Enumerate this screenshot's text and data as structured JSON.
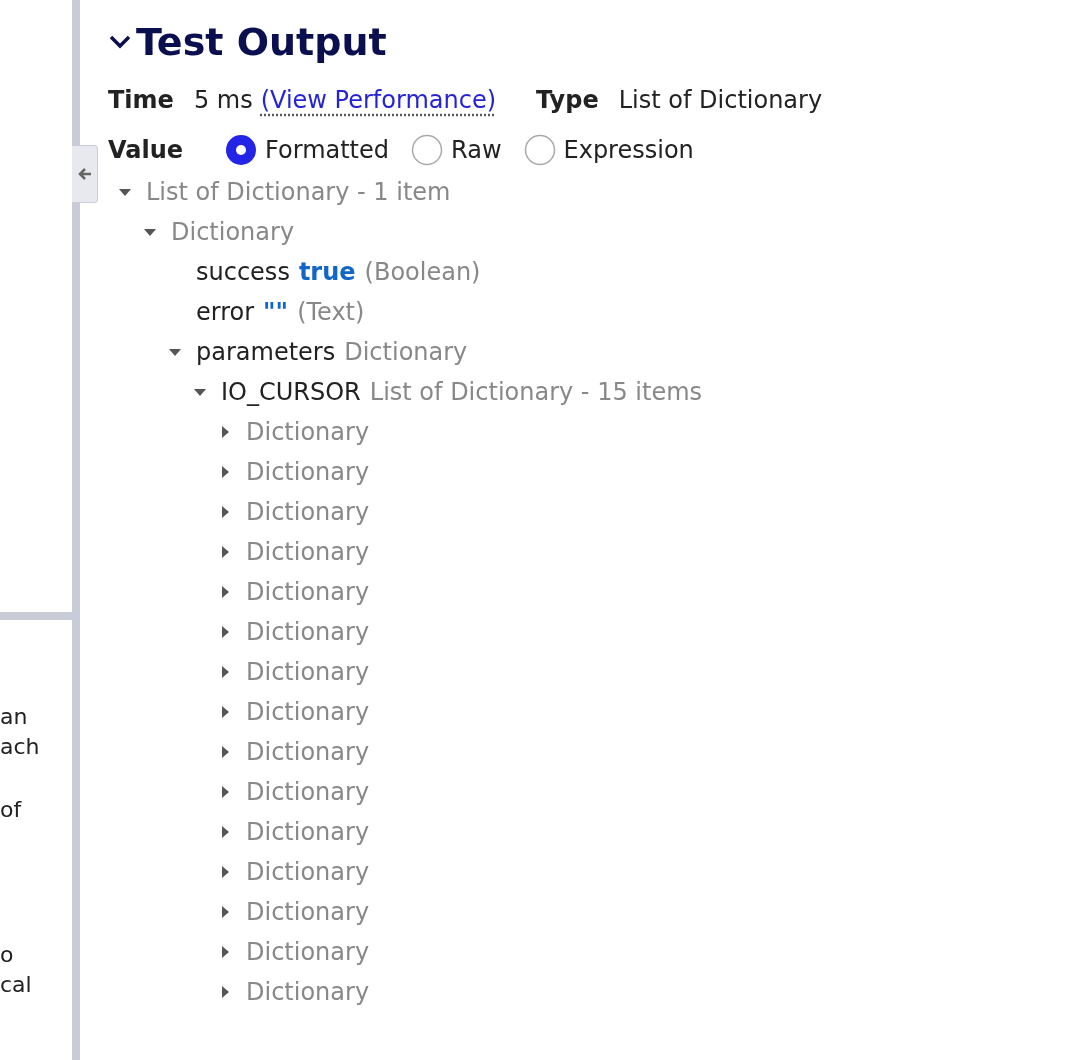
{
  "side_panel": {
    "text_fragments": [
      [
        "an",
        "ach"
      ],
      [
        "of"
      ],
      [
        "o",
        "cal"
      ]
    ]
  },
  "test_output": {
    "title": "Test Output",
    "expanded": true,
    "time_label": "Time",
    "time_value": "5 ms",
    "performance_link": "(View Performance)",
    "type_label": "Type",
    "type_value": "List of Dictionary",
    "value_label": "Value",
    "view_modes": [
      {
        "label": "Formatted",
        "selected": true
      },
      {
        "label": "Raw",
        "selected": false
      },
      {
        "label": "Expression",
        "selected": false
      }
    ],
    "tree": [
      {
        "label": "List of Dictionary - 1 item",
        "expanded": true,
        "children": [
          {
            "label": "Dictionary",
            "expanded": true,
            "children": [
              {
                "key": "success",
                "value": "true",
                "type": "(Boolean)"
              },
              {
                "key": "error",
                "value": "\"\"",
                "type": "(Text)"
              },
              {
                "key": "parameters",
                "label": "Dictionary",
                "expanded": true,
                "children": [
                  {
                    "key": "IO_CURSOR",
                    "label": "List of Dictionary - 15 items",
                    "expanded": true,
                    "children": [
                      {
                        "label": "Dictionary",
                        "expanded": false
                      },
                      {
                        "label": "Dictionary",
                        "expanded": false
                      },
                      {
                        "label": "Dictionary",
                        "expanded": false
                      },
                      {
                        "label": "Dictionary",
                        "expanded": false
                      },
                      {
                        "label": "Dictionary",
                        "expanded": false
                      },
                      {
                        "label": "Dictionary",
                        "expanded": false
                      },
                      {
                        "label": "Dictionary",
                        "expanded": false
                      },
                      {
                        "label": "Dictionary",
                        "expanded": false
                      },
                      {
                        "label": "Dictionary",
                        "expanded": false
                      },
                      {
                        "label": "Dictionary",
                        "expanded": false
                      },
                      {
                        "label": "Dictionary",
                        "expanded": false
                      },
                      {
                        "label": "Dictionary",
                        "expanded": false
                      },
                      {
                        "label": "Dictionary",
                        "expanded": false
                      },
                      {
                        "label": "Dictionary",
                        "expanded": false
                      },
                      {
                        "label": "Dictionary",
                        "expanded": false
                      }
                    ]
                  }
                ]
              }
            ]
          }
        ]
      }
    ]
  }
}
